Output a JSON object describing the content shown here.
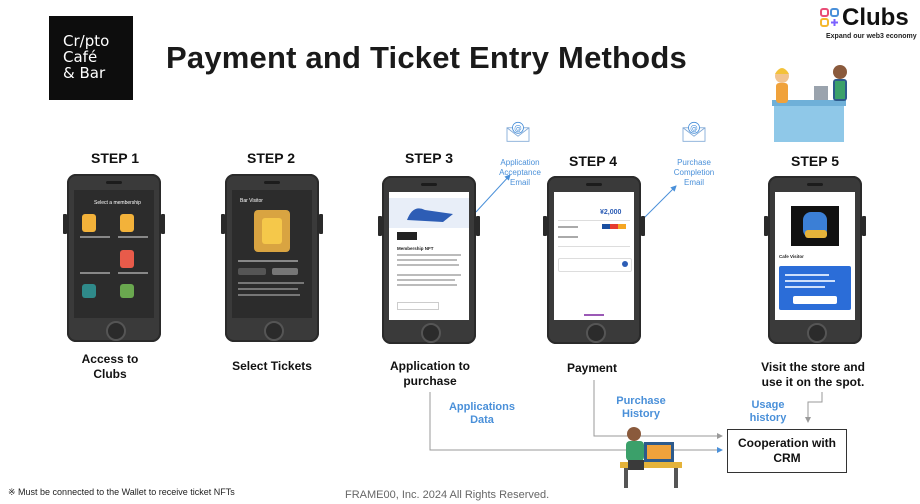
{
  "logo": {
    "line1": "Cr/pto",
    "line2": "Café",
    "line3": "& Bar"
  },
  "title": "Payment and Ticket Entry Methods",
  "brand": {
    "name": "Clubs",
    "tagline": "Expand our web3 economy",
    "colors": [
      "#e94e77",
      "#4a90d9",
      "#f5b82e",
      "#7b61ff"
    ]
  },
  "steps": [
    {
      "label": "STEP 1",
      "caption_lines": [
        "Access to",
        "Clubs"
      ],
      "screen_title": "Select a membership"
    },
    {
      "label": "STEP 2",
      "caption_lines": [
        "Select Tickets"
      ],
      "screen_title": "Bar Visitor"
    },
    {
      "label": "STEP 3",
      "caption_lines": [
        "Application to",
        "purchase"
      ],
      "screen_title": "Membership NFT"
    },
    {
      "label": "STEP 4",
      "caption_lines": [
        "Payment"
      ],
      "screen_price": "¥2,000"
    },
    {
      "label": "STEP 5",
      "caption_lines": [
        "Visit the store and",
        "use it on the spot."
      ],
      "screen_title": "Cafe Visitor"
    }
  ],
  "emails": [
    {
      "lines": [
        "Application",
        "Acceptance",
        "Email"
      ]
    },
    {
      "lines": [
        "Purchase",
        "Completion",
        "Email"
      ]
    }
  ],
  "flow_labels": {
    "applications": [
      "Applications",
      "Data"
    ],
    "purchase_history": [
      "Purchase",
      "History"
    ],
    "usage_history": [
      "Usage",
      "history"
    ]
  },
  "crm": [
    "Cooperation with",
    "CRM"
  ],
  "footnote": "※ Must be connected to the Wallet to receive ticket NFTs",
  "copyright": "FRAME00, Inc. 2024 All Rights Reserved.",
  "accent_color": "#4a90d9",
  "icons": [
    "email-envelope-icon",
    "clubs-logo-icon",
    "cafe-staff-illustration",
    "office-worker-illustration"
  ]
}
